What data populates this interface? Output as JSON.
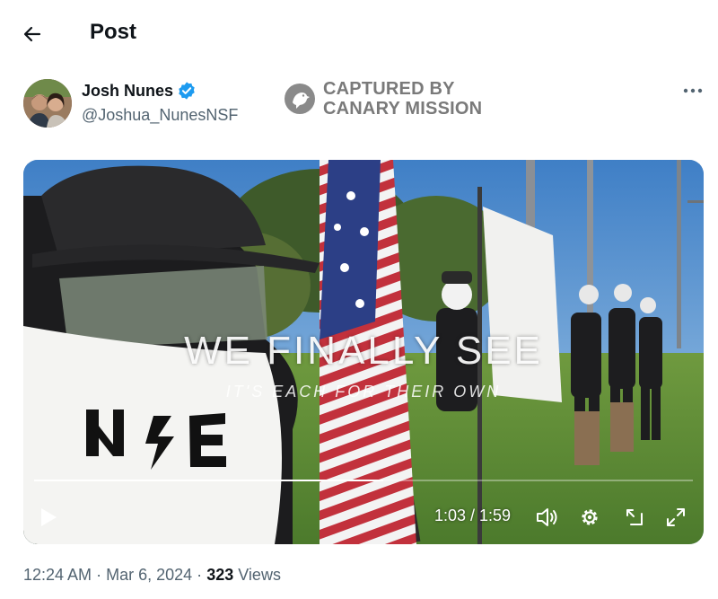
{
  "header": {
    "title": "Post"
  },
  "author": {
    "name": "Josh Nunes",
    "handle": "@Joshua_NunesNSF",
    "verified": true
  },
  "watermark": {
    "line1": "CAPTURED BY",
    "line2": "CANARY MISSION"
  },
  "video": {
    "overlay_title": "WE FINALLY SEE",
    "overlay_subtitle": "IT'S EACH FOR THEIR OWN",
    "current_time": "1:03",
    "duration": "1:59",
    "time_display": "1:03 / 1:59",
    "progress_fraction": 0.53,
    "controls": [
      "play-icon",
      "volume-icon",
      "settings-gear-icon",
      "picture-in-picture-icon",
      "fullscreen-icon"
    ]
  },
  "meta": {
    "time": "12:24 AM",
    "separator": "·",
    "date": "Mar 6, 2024",
    "views_count": "323",
    "views_label": "Views"
  },
  "colors": {
    "verified_blue": "#1d9bf0",
    "secondary_text": "#536471",
    "primary_text": "#0f1419"
  }
}
